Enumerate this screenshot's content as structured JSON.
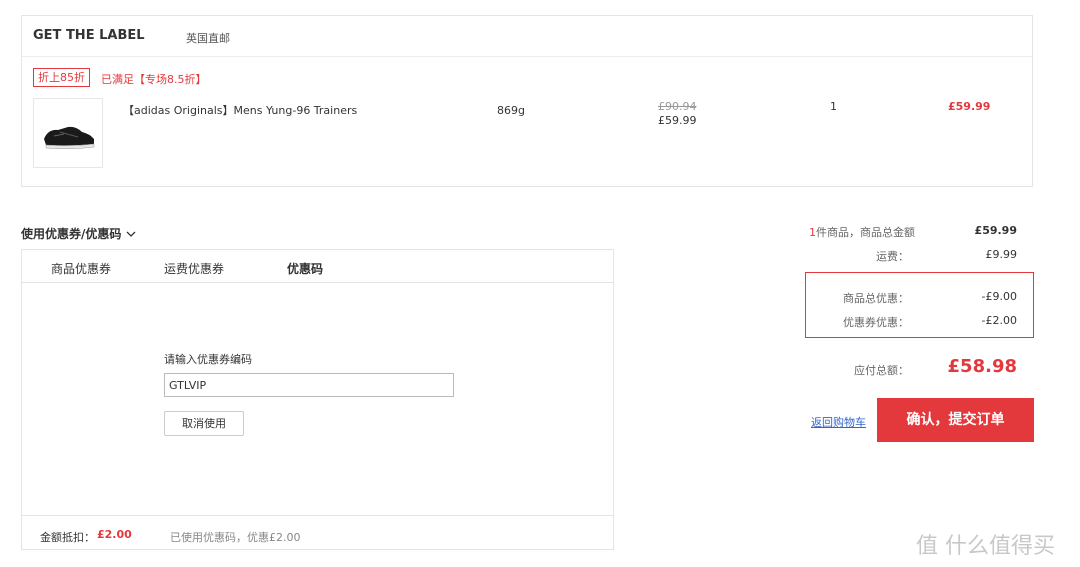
{
  "order": {
    "store_name": "GET THE LABEL",
    "store_tag": "英国直邮",
    "promo_badge": "折上85折",
    "promo_text": "已满足【专场8.5折】",
    "item": {
      "name": "【adidas Originals】Mens Yung-96 Trainers",
      "weight": "869g",
      "original_price": "£90.94",
      "unit_price": "£59.99",
      "quantity": "1",
      "line_total": "£59.99"
    }
  },
  "coupon": {
    "section_title": "使用优惠券/优惠码",
    "tabs": [
      {
        "label": "商品优惠券"
      },
      {
        "label": "运费优惠券"
      },
      {
        "label": "优惠码"
      }
    ],
    "code_label": "请输入优惠券编码",
    "code_value": "GTLVIP",
    "cancel_label": "取消使用",
    "footer_label": "金额抵扣：",
    "footer_amount": "£2.00",
    "footer_note": "已使用优惠码，优惠£2.00"
  },
  "summary": {
    "item_count": "1",
    "item_count_suffix": "件商品，商品总金额",
    "items_total": "£59.99",
    "shipping_label": "运费：",
    "shipping_value": "£9.99",
    "goods_discount_label": "商品总优惠：",
    "goods_discount_value": "-£9.00",
    "coupon_discount_label": "优惠券优惠：",
    "coupon_discount_value": "-£2.00",
    "payable_label": "应付总额：",
    "payable_value": "£58.98",
    "back_link": "返回购物车",
    "submit_label": "确认，提交订单"
  },
  "watermark": "值 什么值得买",
  "colors": {
    "accent": "#e4393c",
    "link": "#3366cc",
    "border": "#e4e4e4"
  }
}
